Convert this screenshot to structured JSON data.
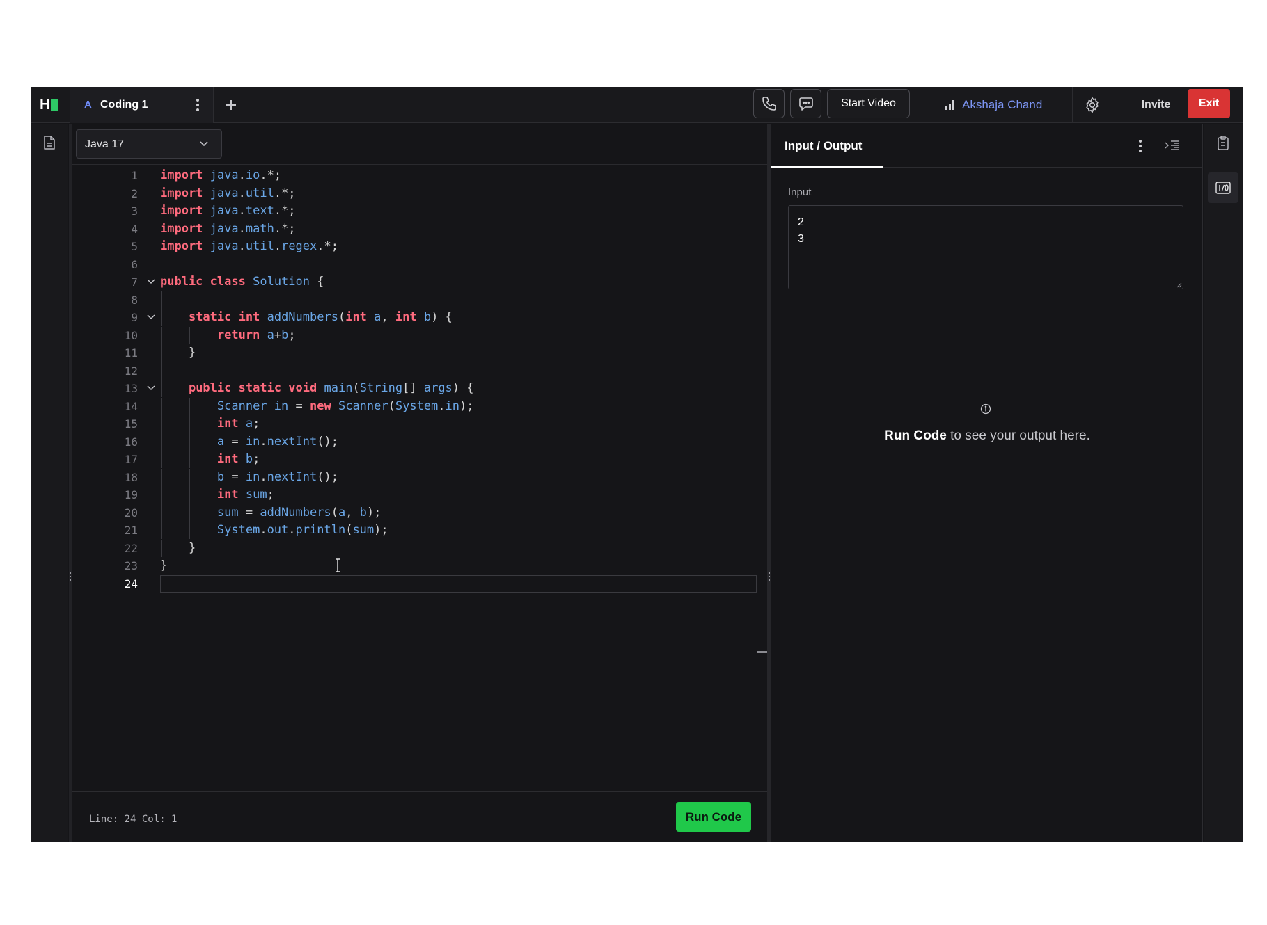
{
  "header": {
    "logo_text": "H",
    "tab": {
      "avatar_letter": "A",
      "label": "Coding 1"
    },
    "start_video_label": "Start Video",
    "user_name": "Akshaja Chand",
    "invite_label": "Invite",
    "exit_label": "Exit"
  },
  "editor": {
    "language": "Java 17",
    "status": "Line: 24 Col: 1",
    "run_label": "Run Code",
    "lines": [
      [
        [
          "kw",
          "import"
        ],
        [
          "pu",
          " "
        ],
        [
          "id",
          "java"
        ],
        [
          "pu",
          "."
        ],
        [
          "id",
          "io"
        ],
        [
          "pu",
          ".*;"
        ]
      ],
      [
        [
          "kw",
          "import"
        ],
        [
          "pu",
          " "
        ],
        [
          "id",
          "java"
        ],
        [
          "pu",
          "."
        ],
        [
          "id",
          "util"
        ],
        [
          "pu",
          ".*;"
        ]
      ],
      [
        [
          "kw",
          "import"
        ],
        [
          "pu",
          " "
        ],
        [
          "id",
          "java"
        ],
        [
          "pu",
          "."
        ],
        [
          "id",
          "text"
        ],
        [
          "pu",
          ".*;"
        ]
      ],
      [
        [
          "kw",
          "import"
        ],
        [
          "pu",
          " "
        ],
        [
          "id",
          "java"
        ],
        [
          "pu",
          "."
        ],
        [
          "id",
          "math"
        ],
        [
          "pu",
          ".*;"
        ]
      ],
      [
        [
          "kw",
          "import"
        ],
        [
          "pu",
          " "
        ],
        [
          "id",
          "java"
        ],
        [
          "pu",
          "."
        ],
        [
          "id",
          "util"
        ],
        [
          "pu",
          "."
        ],
        [
          "id",
          "regex"
        ],
        [
          "pu",
          ".*;"
        ]
      ],
      [],
      [
        [
          "kw",
          "public"
        ],
        [
          "pu",
          " "
        ],
        [
          "kw",
          "class"
        ],
        [
          "pu",
          " "
        ],
        [
          "cls",
          "Solution"
        ],
        [
          "pu",
          " {"
        ]
      ],
      [],
      [
        [
          "pu",
          "    "
        ],
        [
          "kw",
          "static"
        ],
        [
          "pu",
          " "
        ],
        [
          "kw",
          "int"
        ],
        [
          "pu",
          " "
        ],
        [
          "id",
          "addNumbers"
        ],
        [
          "pu",
          "("
        ],
        [
          "kw",
          "int"
        ],
        [
          "pu",
          " "
        ],
        [
          "id",
          "a"
        ],
        [
          "pu",
          ", "
        ],
        [
          "kw",
          "int"
        ],
        [
          "pu",
          " "
        ],
        [
          "id",
          "b"
        ],
        [
          "pu",
          ") {"
        ]
      ],
      [
        [
          "pu",
          "        "
        ],
        [
          "kw",
          "return"
        ],
        [
          "pu",
          " "
        ],
        [
          "id",
          "a"
        ],
        [
          "pu",
          "+"
        ],
        [
          "id",
          "b"
        ],
        [
          "pu",
          ";"
        ]
      ],
      [
        [
          "pu",
          "    }"
        ]
      ],
      [],
      [
        [
          "pu",
          "    "
        ],
        [
          "kw",
          "public"
        ],
        [
          "pu",
          " "
        ],
        [
          "kw",
          "static"
        ],
        [
          "pu",
          " "
        ],
        [
          "kw",
          "void"
        ],
        [
          "pu",
          " "
        ],
        [
          "id",
          "main"
        ],
        [
          "pu",
          "("
        ],
        [
          "cls",
          "String"
        ],
        [
          "pu",
          "[] "
        ],
        [
          "id",
          "args"
        ],
        [
          "pu",
          ") {"
        ]
      ],
      [
        [
          "pu",
          "        "
        ],
        [
          "cls",
          "Scanner"
        ],
        [
          "pu",
          " "
        ],
        [
          "id",
          "in"
        ],
        [
          "pu",
          " = "
        ],
        [
          "kw",
          "new"
        ],
        [
          "pu",
          " "
        ],
        [
          "cls",
          "Scanner"
        ],
        [
          "pu",
          "("
        ],
        [
          "cls",
          "System"
        ],
        [
          "pu",
          "."
        ],
        [
          "id",
          "in"
        ],
        [
          "pu",
          ");"
        ]
      ],
      [
        [
          "pu",
          "        "
        ],
        [
          "kw",
          "int"
        ],
        [
          "pu",
          " "
        ],
        [
          "id",
          "a"
        ],
        [
          "pu",
          ";"
        ]
      ],
      [
        [
          "pu",
          "        "
        ],
        [
          "id",
          "a"
        ],
        [
          "pu",
          " = "
        ],
        [
          "id",
          "in"
        ],
        [
          "pu",
          "."
        ],
        [
          "id",
          "nextInt"
        ],
        [
          "pu",
          "();"
        ]
      ],
      [
        [
          "pu",
          "        "
        ],
        [
          "kw",
          "int"
        ],
        [
          "pu",
          " "
        ],
        [
          "id",
          "b"
        ],
        [
          "pu",
          ";"
        ]
      ],
      [
        [
          "pu",
          "        "
        ],
        [
          "id",
          "b"
        ],
        [
          "pu",
          " = "
        ],
        [
          "id",
          "in"
        ],
        [
          "pu",
          "."
        ],
        [
          "id",
          "nextInt"
        ],
        [
          "pu",
          "();"
        ]
      ],
      [
        [
          "pu",
          "        "
        ],
        [
          "kw",
          "int"
        ],
        [
          "pu",
          " "
        ],
        [
          "id",
          "sum"
        ],
        [
          "pu",
          ";"
        ]
      ],
      [
        [
          "pu",
          "        "
        ],
        [
          "id",
          "sum"
        ],
        [
          "pu",
          " = "
        ],
        [
          "id",
          "addNumbers"
        ],
        [
          "pu",
          "("
        ],
        [
          "id",
          "a"
        ],
        [
          "pu",
          ", "
        ],
        [
          "id",
          "b"
        ],
        [
          "pu",
          ");"
        ]
      ],
      [
        [
          "pu",
          "        "
        ],
        [
          "cls",
          "System"
        ],
        [
          "pu",
          "."
        ],
        [
          "id",
          "out"
        ],
        [
          "pu",
          "."
        ],
        [
          "id",
          "println"
        ],
        [
          "pu",
          "("
        ],
        [
          "id",
          "sum"
        ],
        [
          "pu",
          ");"
        ]
      ],
      [
        [
          "pu",
          "    }"
        ]
      ],
      [
        [
          "pu",
          "}"
        ]
      ],
      []
    ],
    "fold_lines": [
      7,
      9,
      13
    ],
    "current_line": 24
  },
  "io": {
    "tab_label": "Input / Output",
    "input_label": "Input",
    "input_value": "2\n3",
    "empty_bold": "Run Code",
    "empty_rest": " to see your output here."
  },
  "colors": {
    "keyword": "#ff6b7e",
    "identifier": "#6aa6e6",
    "run_button": "#20c84a",
    "exit_button": "#d93434",
    "user_name": "#7c95f4"
  }
}
